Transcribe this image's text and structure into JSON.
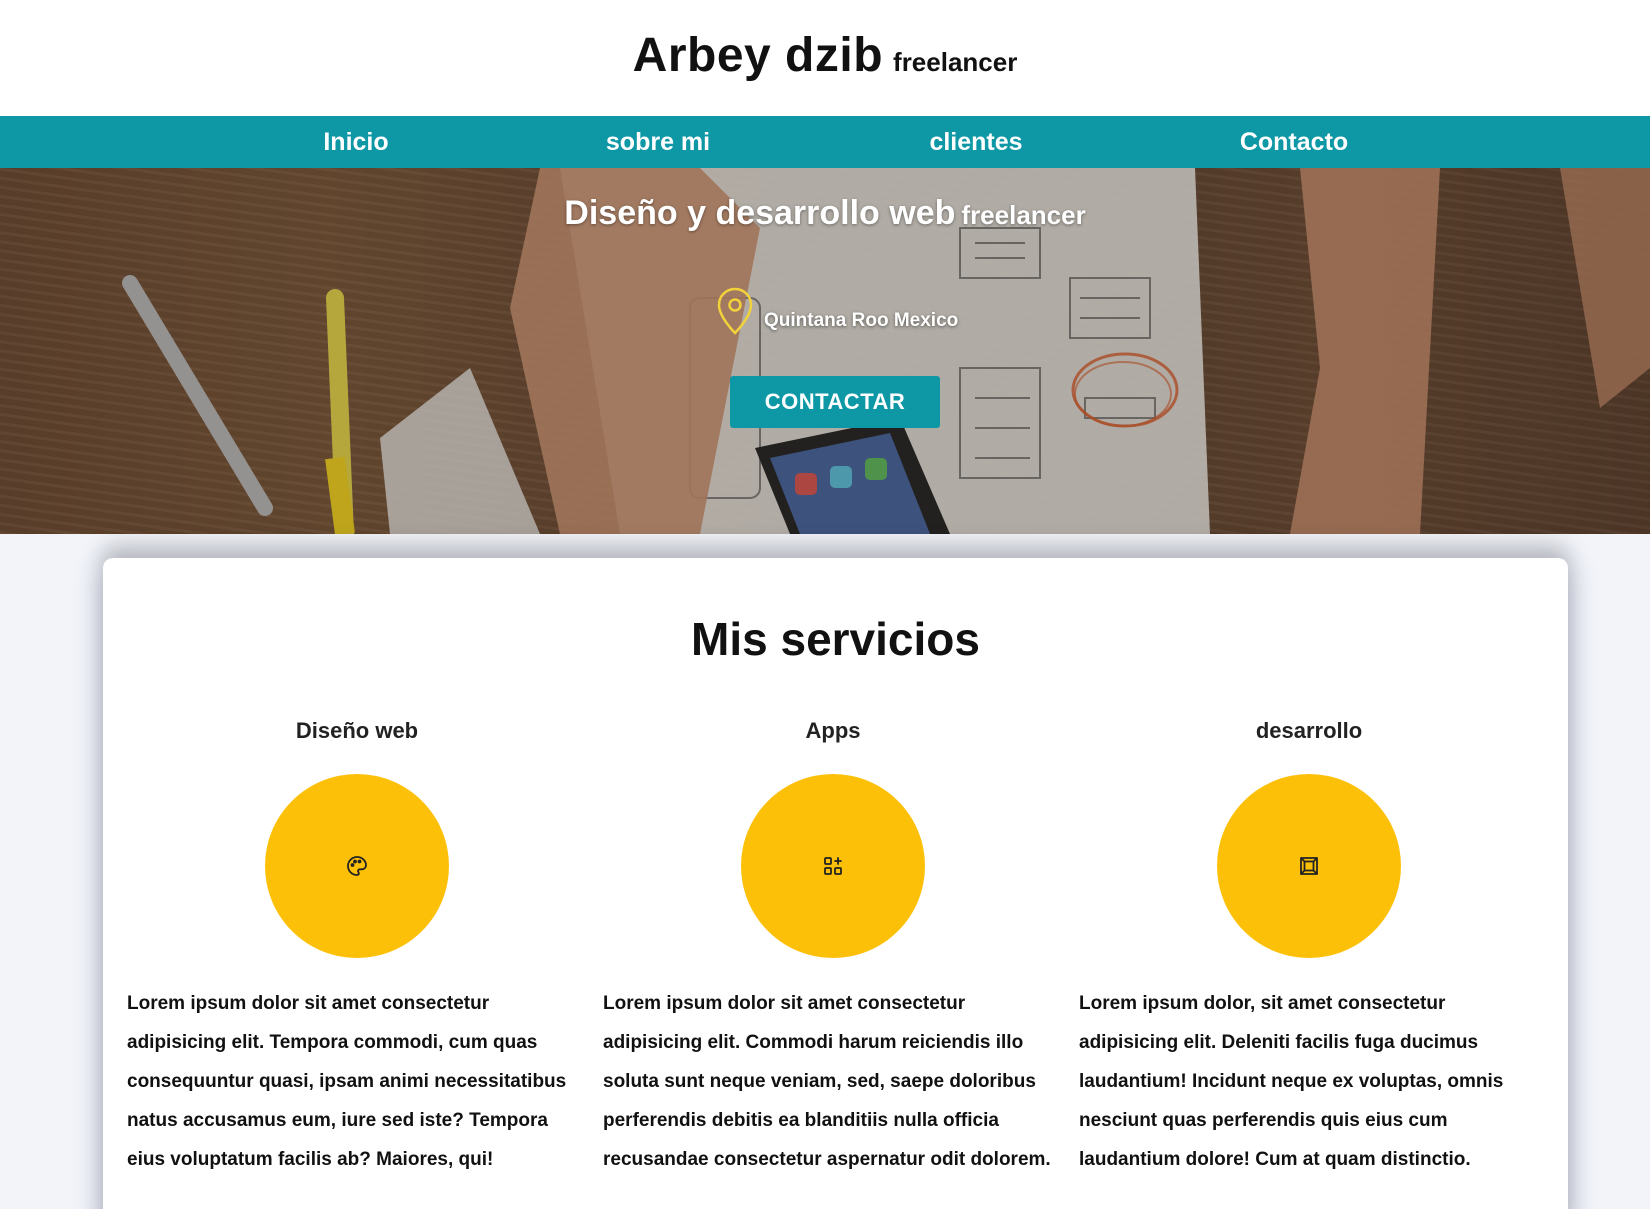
{
  "header": {
    "name": "Arbey dzib",
    "subtitle": "freelancer"
  },
  "nav": {
    "items": [
      {
        "label": "Inicio"
      },
      {
        "label": "sobre mi"
      },
      {
        "label": "clientes"
      },
      {
        "label": "Contacto"
      }
    ]
  },
  "hero": {
    "title": "Diseño y desarrollo web",
    "title_suffix": "freelancer",
    "location": "Quintana Roo Mexico",
    "location_icon": "map-pin-icon",
    "cta_label": "CONTACTAR"
  },
  "services": {
    "title": "Mis servicios",
    "items": [
      {
        "title": "Diseño web",
        "icon": "palette-icon",
        "text": "Lorem ipsum dolor sit amet consectetur adipisicing elit. Tempora commodi, cum quas consequuntur quasi, ipsam animi necessitatibus natus accusamus eum, iure sed iste? Tempora eius voluptatum facilis ab? Maiores, qui!"
      },
      {
        "title": "Apps",
        "icon": "apps-grid-icon",
        "text": "Lorem ipsum dolor sit amet consectetur adipisicing elit. Commodi harum reiciendis illo soluta sunt neque veniam, sed, saepe doloribus perferendis debitis ea blanditiis nulla officia recusandae consectetur aspernatur odit dolorem."
      },
      {
        "title": "desarrollo",
        "icon": "frame-icon",
        "text": "Lorem ipsum dolor, sit amet consectetur adipisicing elit. Deleniti facilis fuga ducimus laudantium! Incidunt neque ex voluptas, omnis nesciunt quas perferendis quis eius cum laudantium dolore! Cum at quam distinctio."
      }
    ]
  },
  "colors": {
    "accent": "#0e98a6",
    "service_circle": "#fdc009",
    "pin": "#f2d23a"
  }
}
